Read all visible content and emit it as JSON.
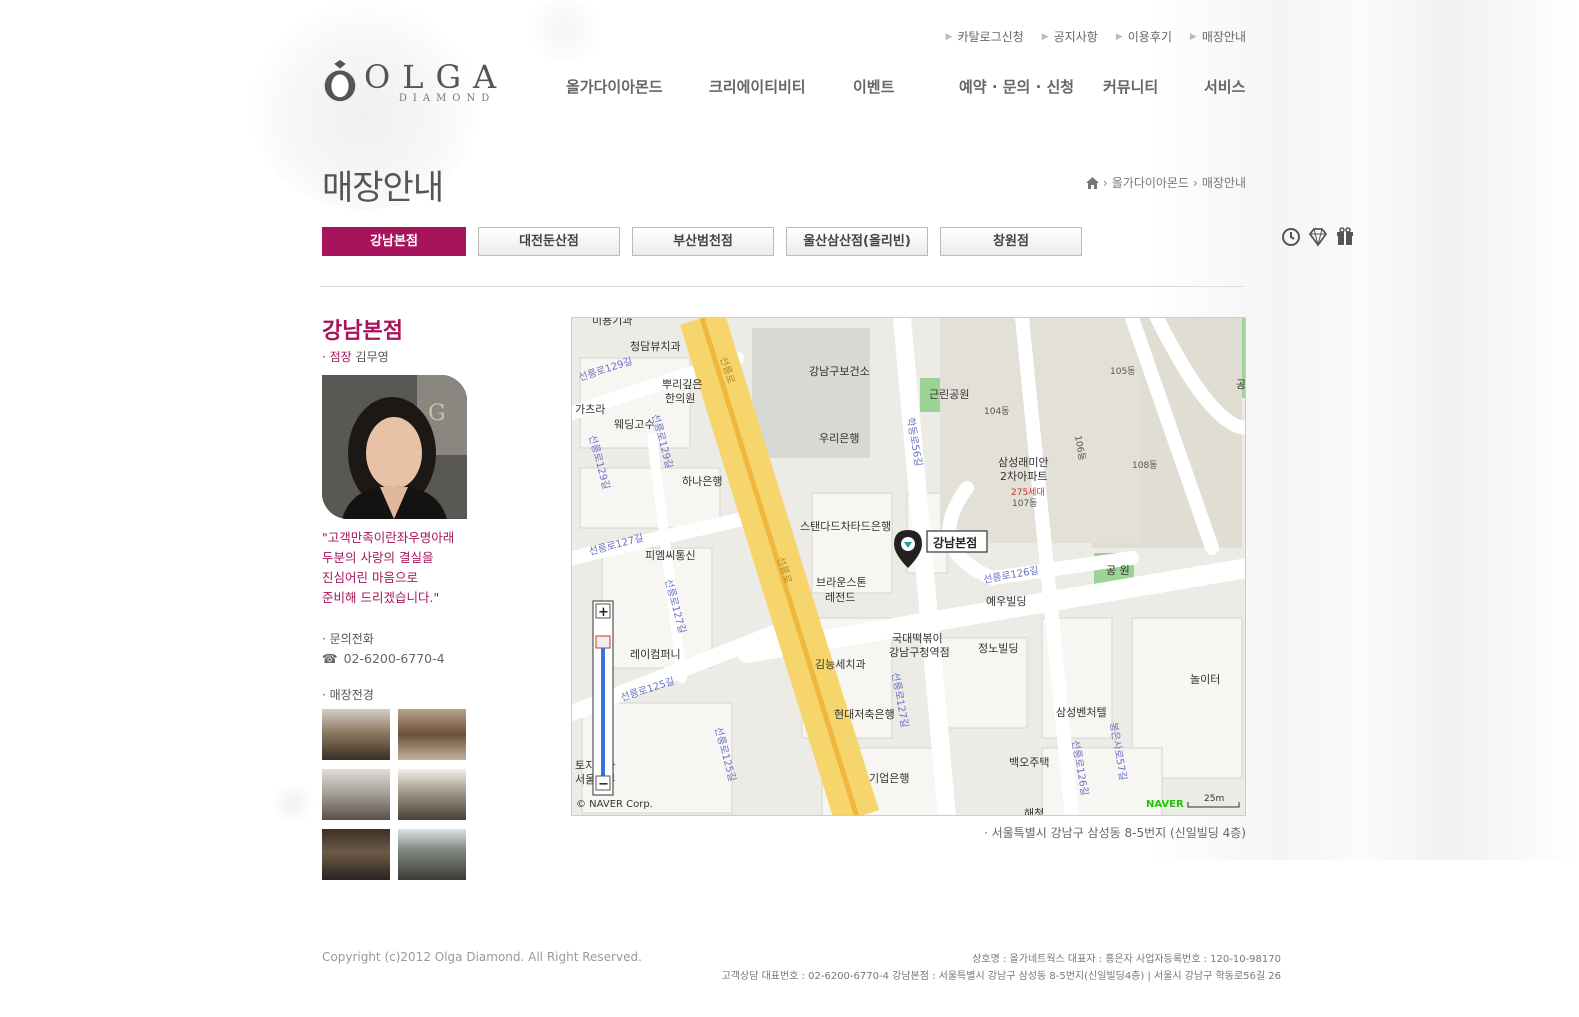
{
  "util_nav": [
    "카탈로그신청",
    "공지사항",
    "이용후기",
    "매장안내"
  ],
  "logo": {
    "name": "OLGA",
    "sub": "DIAMOND"
  },
  "gnb": [
    "올가다이아몬드",
    "크리에이티비티",
    "이벤트",
    "예약 · 문의 · 신청",
    "커뮤니티",
    "서비스"
  ],
  "page_title": "매장안내",
  "breadcrumb": [
    "올가다이아몬드",
    "매장안내"
  ],
  "tabs": [
    "강남본점",
    "대전둔산점",
    "부산범천점",
    "울산삼산점(올리빈)",
    "창원점"
  ],
  "store": {
    "name": "강남본점",
    "manager_label": "· 점장",
    "manager": "김무영",
    "quote": [
      "\"고객만족이란좌우명아래",
      "두분의 사랑의 결실을",
      "진심어린 마음으로",
      "준비해 드리겠습니다.\""
    ],
    "inquiry_label": "· 문의전화",
    "phone_icon": "☎",
    "phone": "02-6200-6770-4",
    "view_label": "· 매장전경"
  },
  "map": {
    "marker_label": "강남본점",
    "copyright": "© NAVER Corp.",
    "naver": "NAVER",
    "scale": "25m",
    "zoom_in": "+",
    "zoom_out": "−",
    "labels": [
      "미용기과",
      "청담뷰치과",
      "선릉로129길",
      "가츠라",
      "뿌리깊은",
      "한의원",
      "웨딩고수",
      "선릉로129길",
      "선릉로129길",
      "하나은행",
      "강남구보건소",
      "우리은행",
      "학동로56길",
      "근린공원",
      "삼성래미안",
      "2차아파트",
      "275세대",
      "104동",
      "105동",
      "106동",
      "107동",
      "108동",
      "스탠다드차타드은행",
      "선릉로127길",
      "피엠씨통신",
      "선릉로127길",
      "브라운스톤",
      "레전드",
      "선릉로126길",
      "예우빌딩",
      "공 원",
      "국대떡볶이",
      "강남구청역점",
      "정노빌딩",
      "레이컴퍼니",
      "김능세치과",
      "선릉로125길",
      "선릉로125길",
      "현대저축은행",
      "선릉로127길",
      "삼성벤처텔",
      "놀이터",
      "백오주택",
      "기업은행",
      "선릉로126길",
      "봉은사로57길",
      "토지공사",
      "서울본부",
      "해청",
      "선릉로",
      "선릉로",
      "공"
    ]
  },
  "address": "· 서울특별시 강남구 삼성동 8-5번지 (신일빌딩 4층)",
  "footer": {
    "copyright": "Copyright (c)2012 Olga Diamond. All Right Reserved.",
    "info1": "상호명 : 올가네트웍스    대표자 : 홍은자    사업자등록번호 : 120-10-98170",
    "info2": "고객상담 대표번호 : 02-6200-6770-4    강남본점 : 서울특별시 강남구 삼성동 8-5번지(신일빌딩4층) | 서울시 강남구 학동로56길 26"
  },
  "colors": {
    "accent": "#a8145b",
    "road_main": "#f5d56c",
    "park": "#8fcf88"
  }
}
